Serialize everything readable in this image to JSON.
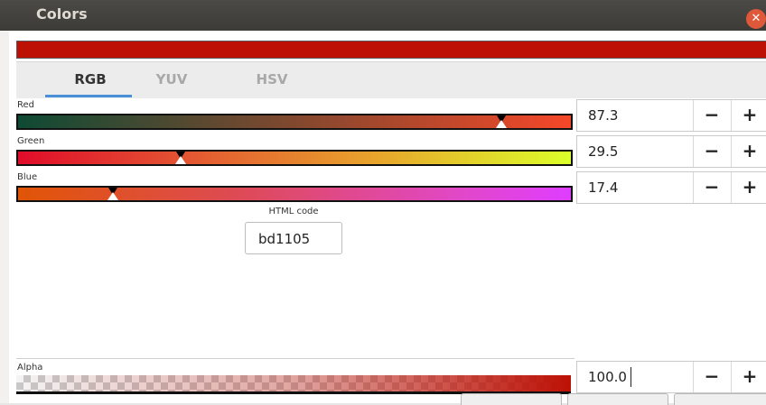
{
  "window": {
    "title": "Colors",
    "close_icon": "close-icon"
  },
  "current_color": "#bd1105",
  "tabs": [
    {
      "label": "RGB",
      "active": true
    },
    {
      "label": "YUV",
      "active": false
    },
    {
      "label": "HSV",
      "active": false
    }
  ],
  "channels": [
    {
      "label": "Red",
      "value": "87.3",
      "minus": "−",
      "plus": "+"
    },
    {
      "label": "Green",
      "value": "29.5",
      "minus": "−",
      "plus": "+"
    },
    {
      "label": "Blue",
      "value": "17.4",
      "minus": "−",
      "plus": "+"
    }
  ],
  "html_code": {
    "label": "HTML code",
    "value": "bd1105"
  },
  "alpha": {
    "label": "Alpha",
    "value": "100.0",
    "minus": "−",
    "plus": "+"
  }
}
